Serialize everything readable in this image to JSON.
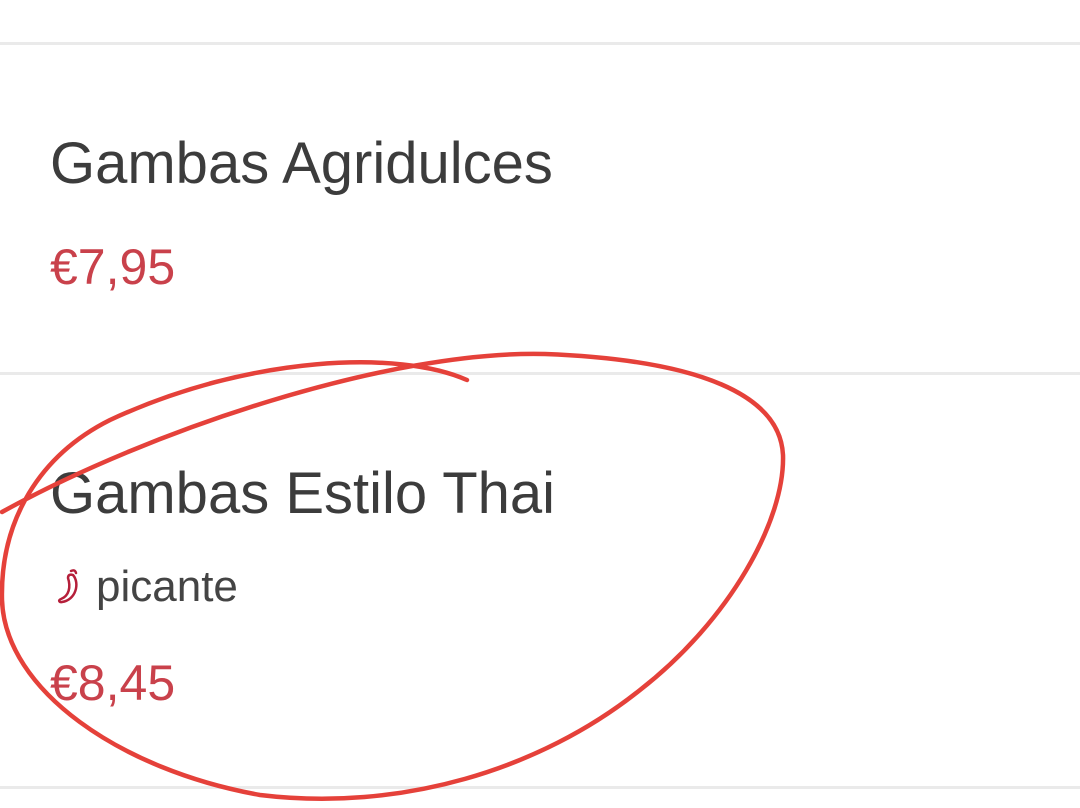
{
  "menu": {
    "items": [
      {
        "name": "Gambas Agridulces",
        "price": "€7,95"
      },
      {
        "name": "Gambas Estilo Thai",
        "tag": {
          "icon": "chili-pepper-icon",
          "label": "picante"
        },
        "price": "€8,45"
      }
    ]
  },
  "colors": {
    "price": "#c9414b",
    "text": "#3c3c3c",
    "divider": "#eaeaea",
    "annotation": "#e5413a"
  }
}
